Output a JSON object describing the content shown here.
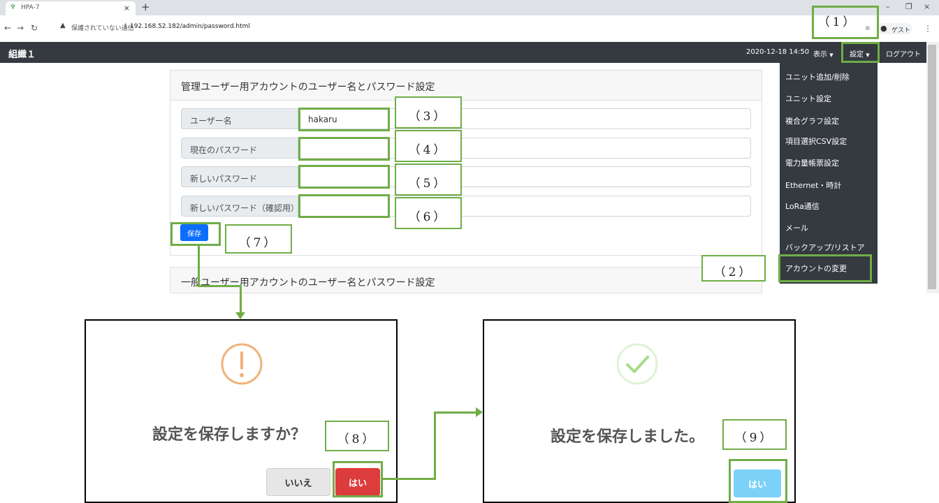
{
  "browser": {
    "tab_title": "HPA-7",
    "security_warning": "保護されていない通信",
    "address_separator": "|",
    "url": "192.168.52.182/admin/password.html",
    "profile_label": "ゲスト"
  },
  "navbar": {
    "brand": "組織１",
    "datetime": "2020-12-18 14:50",
    "view_menu": "表示",
    "settings_menu": "設定",
    "logout": "ログアウト"
  },
  "dropdown": {
    "items": [
      "ユニット追加/削除",
      "ユニット設定",
      "複合グラフ設定",
      "項目選択CSV設定",
      "電力量帳票設定",
      "Ethernet・時計",
      "LoRa通信",
      "メール",
      "バックアップ/リストア",
      "アカウントの変更"
    ]
  },
  "admin_card": {
    "title": "管理ユーザー用アカウントのユーザー名とパスワード設定",
    "fields": [
      {
        "label": "ユーザー名",
        "value": "hakaru"
      },
      {
        "label": "現在のパスワード",
        "value": ""
      },
      {
        "label": "新しいパスワード",
        "value": ""
      },
      {
        "label": "新しいパスワード（確認用）",
        "value": ""
      }
    ],
    "save_label": "保存"
  },
  "general_card": {
    "title": "一般ユーザー用アカウントのユーザー名とパスワード設定"
  },
  "confirm_dialog": {
    "message": "設定を保存しますか？",
    "no_label": "いいえ",
    "yes_label": "はい"
  },
  "success_dialog": {
    "message": "設定を保存しました。",
    "ok_label": "はい"
  },
  "annotations": {
    "n1": "（1）",
    "n2": "（2）",
    "n3": "（3）",
    "n4": "（4）",
    "n5": "（5）",
    "n6": "（6）",
    "n7": "（7）",
    "n8": "（8）",
    "n9": "（9）"
  },
  "colors": {
    "annotation": "#70ad47",
    "navbar": "#343a40",
    "save_button": "#0d6efd",
    "yes_button": "#dd3c3c",
    "ok_button": "#7cd1f9",
    "warning_icon": "#f0b27a",
    "success_icon": "#a5dc86"
  }
}
